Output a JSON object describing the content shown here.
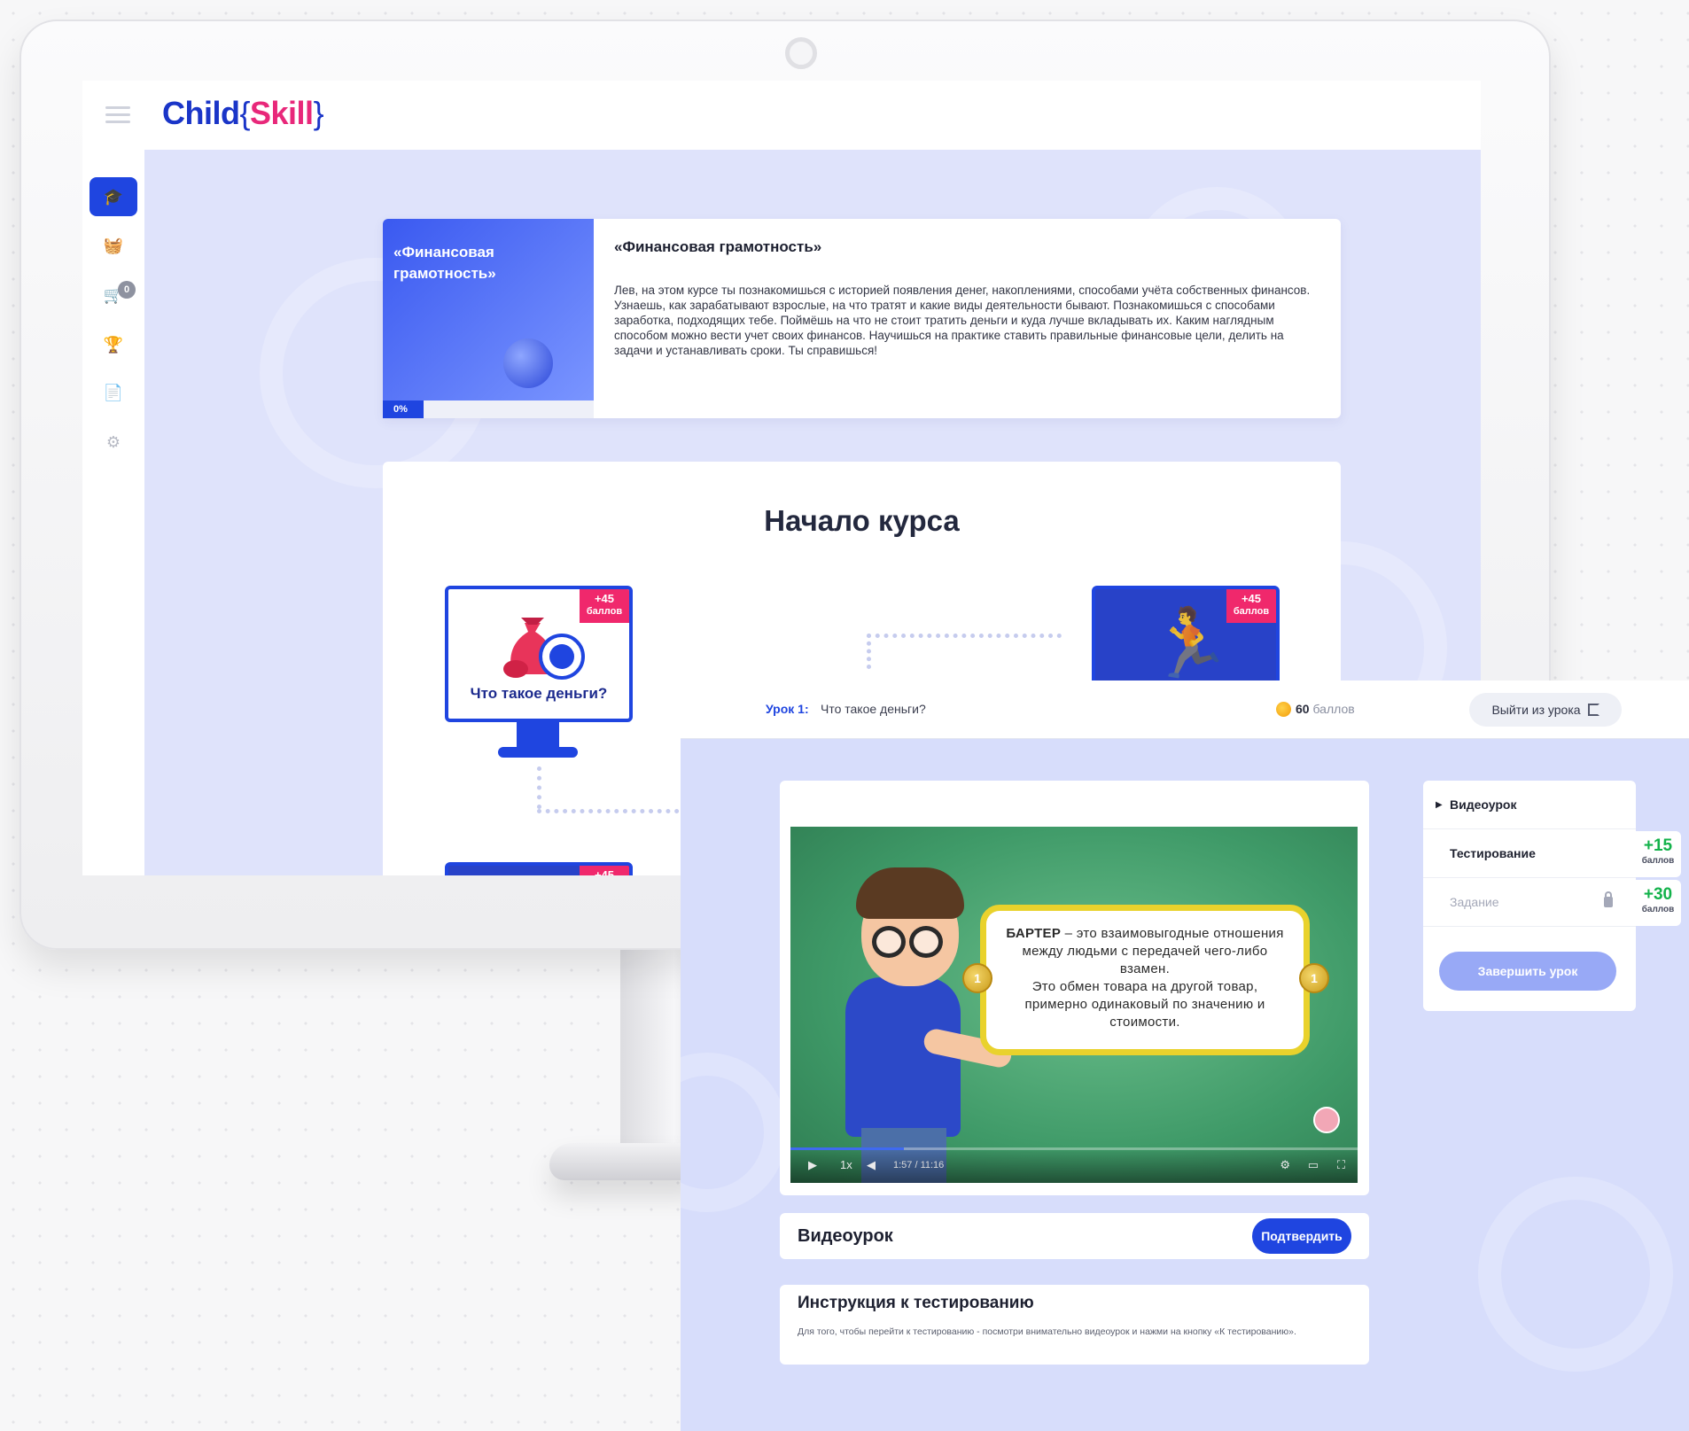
{
  "brand": {
    "name_prefix": "Child",
    "brace_open": "{",
    "name_accent": "Skill",
    "brace_close": "}"
  },
  "sidebar": {
    "items": [
      "graduation-cap-icon",
      "basket-icon",
      "cart-icon",
      "trophy-icon",
      "document-icon",
      "gear-icon"
    ],
    "cart_count": "0"
  },
  "course": {
    "thumb_title": "«Финансовая грамотность»",
    "progress": "0%",
    "title": "«Финансовая грамотность»",
    "description": "Лев, на этом курсе ты познакомишься с историей появления денег, накоплениями, способами учёта собственных финансов. Узнаешь, как зарабатывают взрослые, на что тратят и какие виды деятельности бывают. Познакомишься с способами заработка, подходящих тебе. Поймёшь на что не стоит тратить деньги и куда лучше вкладывать их. Каким наглядным способом можно вести учет своих финансов. Научишься на практике ставить правильные финансовые цели, делить на задачи и устанавливать сроки. Ты справишься!"
  },
  "start": {
    "title": "Начало курса",
    "lessons": [
      {
        "label": "Что такое деньги?",
        "points": "+45",
        "points_unit": "баллов"
      },
      {
        "label": "",
        "points": "+45",
        "points_unit": "баллов"
      },
      {
        "label": "",
        "points": "+45",
        "points_unit": ""
      }
    ]
  },
  "lesson": {
    "number_label": "Урок 1:",
    "name": "Что такое деньги?",
    "points_value": "60",
    "points_unit": "баллов",
    "exit_label": "Выйти из урока",
    "video": {
      "term": "БАРТЕР",
      "definition": " – это взаимовыгодные отношения между людьми с передачей чего-либо взамен.",
      "definition_2": "Это обмен товара на другой товар, примерно одинаковый по значению и стоимости.",
      "coin_label": "1",
      "speed": "1x",
      "time": "1:57 / 11:16",
      "progress_fraction": 0.2
    },
    "tasks": [
      {
        "label": "Видеоурок",
        "state": "active"
      },
      {
        "label": "Тестирование",
        "points": "+15",
        "points_unit": "баллов"
      },
      {
        "label": "Задание",
        "locked": true,
        "points": "+30",
        "points_unit": "баллов"
      }
    ],
    "finish_label": "Завершить урок",
    "video_section_title": "Видеоурок",
    "confirm_label": "Подтвердить",
    "instruction_title": "Инструкция к тестированию",
    "instruction_text": "Для того, чтобы перейти к тестированию - посмотри внимательно видеоурок и нажми на кнопку «К тестированию»."
  },
  "colors": {
    "brand_blue": "#1f45e0",
    "brand_pink": "#e8287a",
    "points_green": "#12b24a",
    "badge_pink": "#f0286c"
  }
}
